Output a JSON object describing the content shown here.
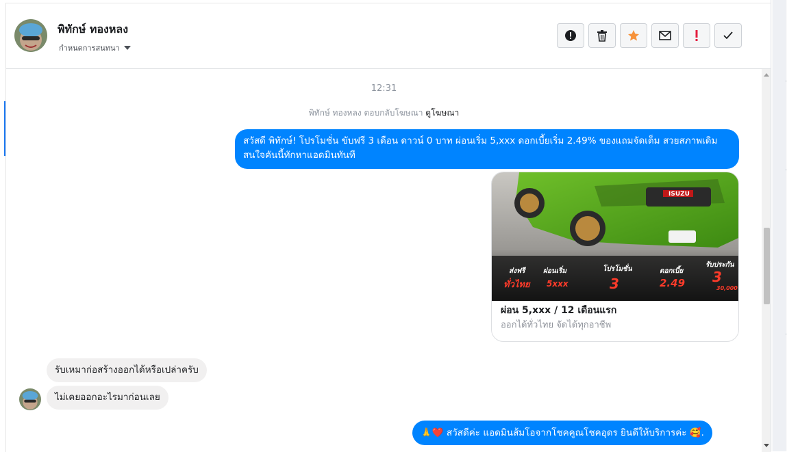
{
  "header": {
    "name": "พิทักษ์ ทองหลง",
    "subtitle": "กำหนดการสนทนา",
    "actions": [
      "report",
      "delete",
      "star",
      "mark-unread",
      "important",
      "done"
    ]
  },
  "thread": {
    "timestamp": "12:31",
    "reply_note_prefix": "พิทักษ์ ทองหลง ตอบกลับโฆษณา",
    "reply_note_link": "ดูโฆษณา",
    "message_1": "สวัสดี พิทักษ์! โปรโมชั่น ขับฟรี 3 เดือน ดาวน์ 0 บาท ผ่อนเริ่ม 5,xxx  ดอกเบี้ยเริ่ม 2.49% ของแถมจัดเต็ม สวยสภาพเดิม สนใจคันนี้ทักหาแอดมินทันที",
    "card": {
      "title": "ผ่อน 5,xxx / 12 เดือนแรก",
      "subtitle": "ออกได้ทั่วไทย จัดได้ทุกอาชีพ",
      "banner": {
        "col1_top": "ส่งฟรี",
        "col1_main": "ทั่วไทย",
        "col2_top": "ผ่อนเริ่ม",
        "col2_main": "5xxx",
        "col3_top": "โปรโมชั่น",
        "col3_main": "3",
        "col4_top": "ดอกเบี้ย",
        "col4_main": "2.49",
        "col5_top": "รับประกัน",
        "col5_main": "3",
        "col5_sub": "30,000",
        "plate": "ISUZU"
      }
    },
    "incoming_1": "รับเหมาก่อสร้างออกได้หรือเปล่าครับ",
    "incoming_2": "ไม่เคยออกอะไรมาก่อนเลย",
    "message_2": "สวัสดีค่ะ แอดมินส้มโอจากโชคคูณโชคอุดร ยินดีให้บริการค่ะ",
    "message_2_emoji_lead": "🙏❤️",
    "message_2_emoji_tail": "🥰."
  },
  "colors": {
    "accent": "#0084ff",
    "star": "#f7923a",
    "important": "#e41e3f"
  }
}
